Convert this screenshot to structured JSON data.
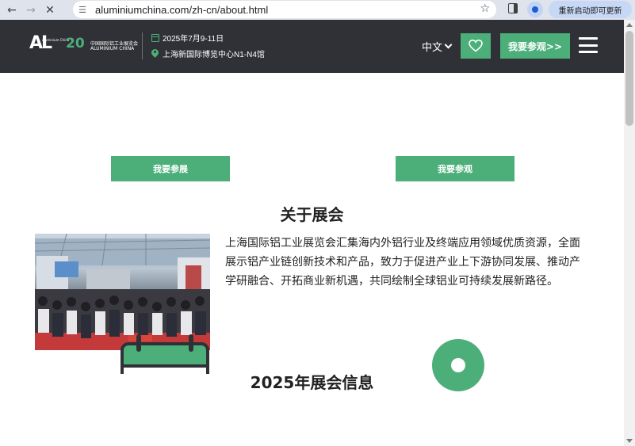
{
  "browser": {
    "url": "aluminiumchina.com/zh-cn/about.html",
    "relaunch_label": "重新启动即可更新",
    "icons": [
      "back-arrow-icon",
      "forward-arrow-icon",
      "stop-loading-icon",
      "site-settings-icon",
      "bookmark-star-icon",
      "side-panel-icon",
      "profile-icon"
    ]
  },
  "header": {
    "logo": {
      "mark": "AL",
      "mark_small": "Aluminium China",
      "anniversary": "20",
      "cn_name": "中国国际铝工业展览会",
      "en_name": "ALUMINIUM CHINA"
    },
    "date": "2025年7月9-11日",
    "location": "上海新国际博览中心N1-N4馆",
    "language": "中文",
    "visit_button": "我要参观>>",
    "colors": {
      "background": "#2f3136",
      "accent": "#4caf7a"
    }
  },
  "main": {
    "cta_exhibit": "我要参展",
    "cta_visit": "我要参观",
    "about_title": "关于展会",
    "about_text": "上海国际铝工业展览会汇集海内外铝行业及终端应用领域优质资源，全面展示铝产业链创新技术和产品，致力于促进产业上下游协同发展、推动产学研融合、开拓商业新机遇，共同绘制全球铝业可持续发展新路径。",
    "info_title": "2025年展会信息",
    "icons": [
      "calendar-icon",
      "location-pin-icon"
    ]
  }
}
